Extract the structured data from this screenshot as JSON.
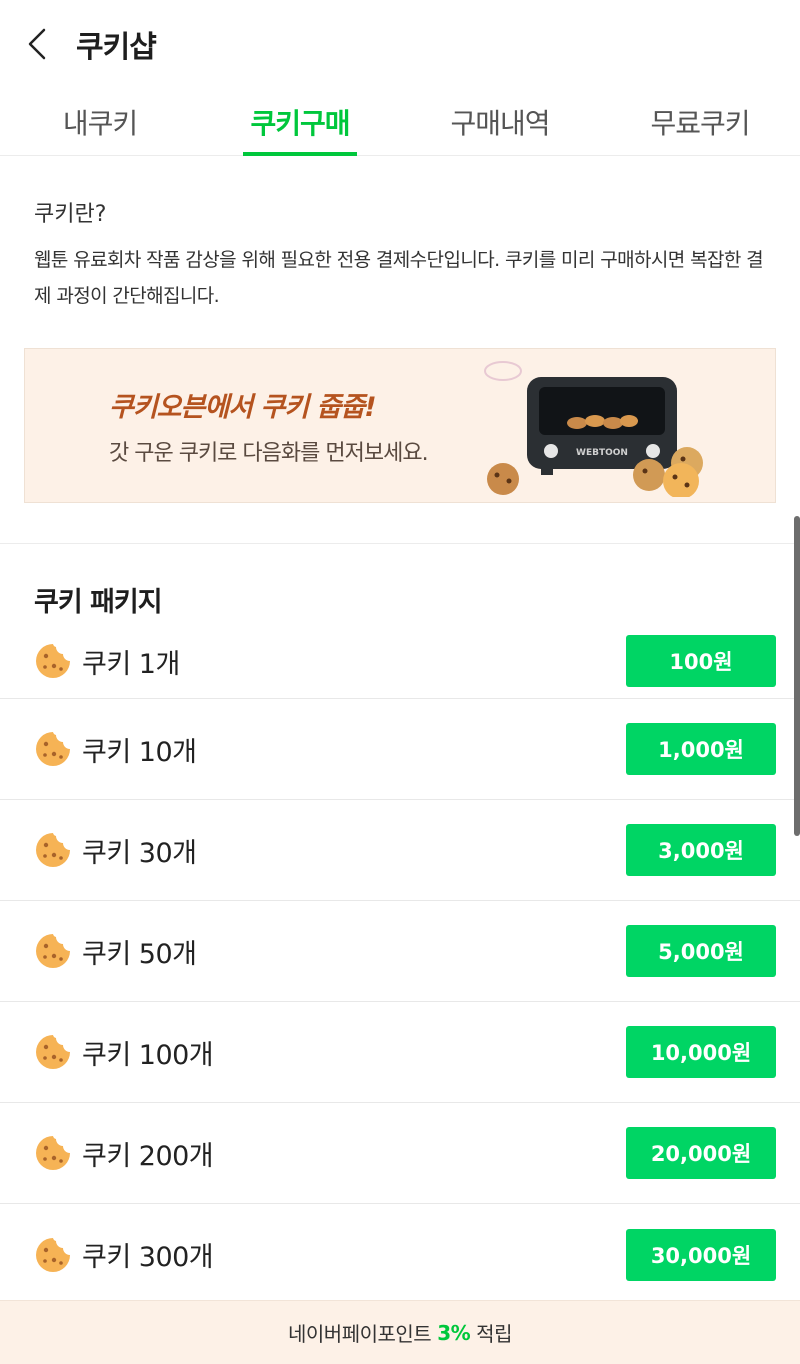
{
  "header": {
    "title": "쿠키샵",
    "back_icon": "chevron-left-icon"
  },
  "tabs": [
    {
      "label": "내쿠키",
      "active": false
    },
    {
      "label": "쿠키구매",
      "active": true
    },
    {
      "label": "구매내역",
      "active": false
    },
    {
      "label": "무료쿠키",
      "active": false
    }
  ],
  "info": {
    "title": "쿠키란?",
    "description": "웹툰 유료회차 작품 감상을 위해 필요한 전용 결제수단입니다. 쿠키를 미리 구매하시면 복잡한 결제 과정이 간단해집니다."
  },
  "banner": {
    "headline": "쿠키오븐에서 쿠키 줍줍!",
    "subtext": "갓 구운 쿠키로 다음화를 먼저보세요.",
    "oven_brand": "WEBTOON"
  },
  "packages": {
    "title": "쿠키 패키지",
    "items": [
      {
        "label": "쿠키 1개",
        "price": "100원"
      },
      {
        "label": "쿠키 10개",
        "price": "1,000원"
      },
      {
        "label": "쿠키 30개",
        "price": "3,000원"
      },
      {
        "label": "쿠키 50개",
        "price": "5,000원"
      },
      {
        "label": "쿠키 100개",
        "price": "10,000원"
      },
      {
        "label": "쿠키 200개",
        "price": "20,000원"
      },
      {
        "label": "쿠키 300개",
        "price": "30,000원"
      }
    ]
  },
  "footer": {
    "prefix": "네이버페이포인트",
    "rate": "3%",
    "suffix": "적립"
  },
  "colors": {
    "accent": "#00c73c",
    "button": "#00d564",
    "banner_bg": "#fdf1e7",
    "banner_headline": "#b5531f",
    "cookie": "#f6b355"
  }
}
